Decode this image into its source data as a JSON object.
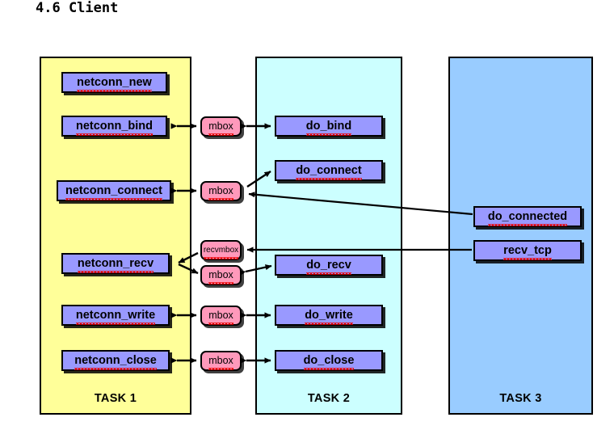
{
  "page": {
    "title": "4.6 Client"
  },
  "colors": {
    "task1_bg": "#ffff99",
    "task2_bg": "#ccffff",
    "task3_bg": "#99ccff",
    "function_box_bg": "#9999ff",
    "mbox_bg": "#ff99bb",
    "border": "#000000",
    "spellcheck_underline": "#ee0000"
  },
  "columns": [
    {
      "id": "task1",
      "label": "TASK 1"
    },
    {
      "id": "task2",
      "label": "TASK 2"
    },
    {
      "id": "task3",
      "label": "TASK 3"
    }
  ],
  "task1_boxes": [
    {
      "label": "netconn_new"
    },
    {
      "label": "netconn_bind"
    },
    {
      "label": "netconn_connect"
    },
    {
      "label": "netconn_recv"
    },
    {
      "label": "netconn_write"
    },
    {
      "label": "netconn_close"
    }
  ],
  "mailboxes": [
    {
      "label": "mbox"
    },
    {
      "label": "mbox"
    },
    {
      "label": "recvmbox"
    },
    {
      "label": "mbox"
    },
    {
      "label": "mbox"
    },
    {
      "label": "mbox"
    }
  ],
  "task2_boxes": [
    {
      "label": "do_bind"
    },
    {
      "label": "do_connect"
    },
    {
      "label": "do_recv"
    },
    {
      "label": "do_write"
    },
    {
      "label": "do_close"
    }
  ],
  "task3_boxes": [
    {
      "label": "do_connected"
    },
    {
      "label": "recv_tcp"
    }
  ]
}
